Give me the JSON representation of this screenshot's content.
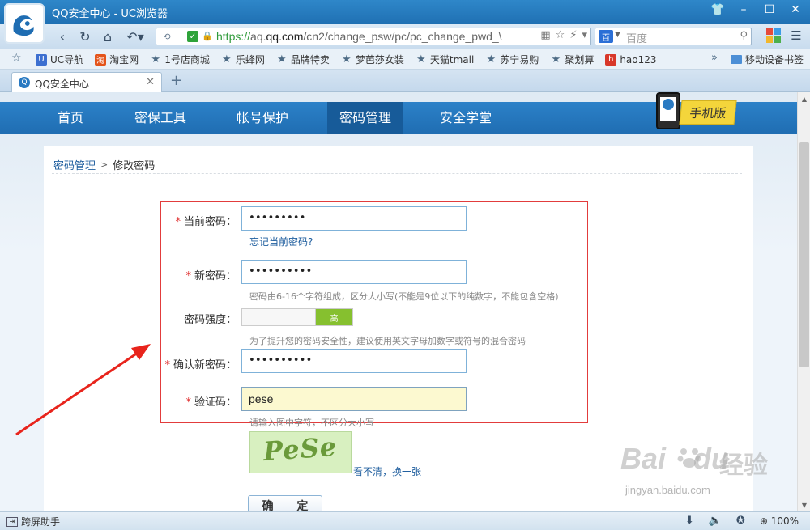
{
  "window": {
    "title": "QQ安全中心 - UC浏览器"
  },
  "address": {
    "scheme": "https://",
    "host_prefix": "aq.",
    "host": "qq.com",
    "path": "/cn2/change_psw/pc/pc_change_pwd_\\"
  },
  "search": {
    "engine": "百",
    "placeholder": "百度"
  },
  "bookmarks": [
    {
      "label": "UC导航",
      "icon": "uc-nav-icon",
      "color": "#3c6fd0"
    },
    {
      "label": "淘宝网",
      "icon": "taobao-icon",
      "color": "#e4541b"
    },
    {
      "label": "1号店商城",
      "icon": "star-icon",
      "color": ""
    },
    {
      "label": "乐蜂网",
      "icon": "star-icon",
      "color": ""
    },
    {
      "label": "品牌特卖",
      "icon": "star-icon",
      "color": ""
    },
    {
      "label": "梦芭莎女装",
      "icon": "star-icon",
      "color": ""
    },
    {
      "label": "天猫tmall",
      "icon": "star-icon",
      "color": ""
    },
    {
      "label": "苏宁易购",
      "icon": "star-icon",
      "color": ""
    },
    {
      "label": "聚划算",
      "icon": "star-icon",
      "color": ""
    },
    {
      "label": "hao123",
      "icon": "hao123-icon",
      "color": "#d8382a"
    }
  ],
  "bookmark_folder": "移动设备书签",
  "tab": {
    "label": "QQ安全中心"
  },
  "site_nav": [
    {
      "label": "首页"
    },
    {
      "label": "密保工具"
    },
    {
      "label": "帐号保护"
    },
    {
      "label": "密码管理"
    },
    {
      "label": "安全学堂"
    }
  ],
  "mobile_badge": "手机版",
  "breadcrumb": {
    "parent": "密码管理",
    "current": "修改密码"
  },
  "form": {
    "current_password": {
      "label": "当前密码：",
      "value": "•••••••••",
      "forgot": "忘记当前密码?"
    },
    "new_password": {
      "label": "新密码：",
      "value": "••••••••••",
      "hint": "密码由6-16个字符组成，区分大小写(不能是9位以下的纯数字，不能包含空格)"
    },
    "strength": {
      "label": "密码强度：",
      "level": "高"
    },
    "strength_hint": "为了提升您的密码安全性，建议使用英文字母加数字或符号的混合密码",
    "confirm_password": {
      "label": "确认新密码：",
      "value": "••••••••••"
    },
    "captcha": {
      "label": "验证码：",
      "value": "pese",
      "hint": "请输入图中字符，不区分大小写",
      "image_text": "PeSe",
      "refresh": "看不清，换一张"
    },
    "submit": "确 定"
  },
  "watermark": {
    "brand": "Bai",
    "brand2": "du",
    "cn": "经验",
    "url": "jingyan.baidu.com"
  },
  "status": {
    "helper": "跨屏助手",
    "zoom": "100%"
  },
  "colors": {
    "accent": "#1f6db2",
    "highlight": "#e23c3c",
    "strength_high": "#86c02f"
  }
}
